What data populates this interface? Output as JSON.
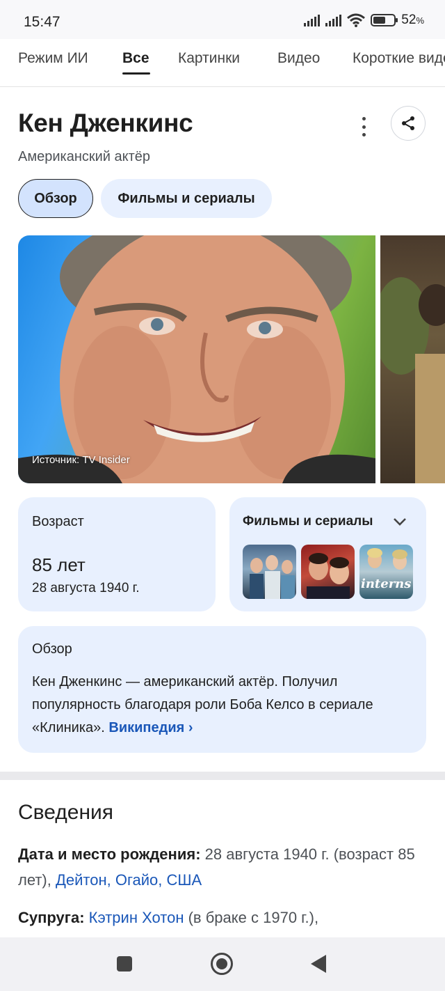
{
  "status_bar": {
    "time": "15:47",
    "battery_percent": "52",
    "battery_unit": "%",
    "icons": [
      "signal-icon",
      "signal-icon",
      "wifi-icon",
      "battery-icon"
    ]
  },
  "tabs": [
    {
      "label": "Режим ИИ",
      "active": false
    },
    {
      "label": "Все",
      "active": true
    },
    {
      "label": "Картинки",
      "active": false
    },
    {
      "label": "Видео",
      "active": false
    },
    {
      "label": "Короткие видео",
      "active": false
    }
  ],
  "knowledge_panel": {
    "title": "Кен Дженкинс",
    "subtitle": "Американский актёр",
    "chips": [
      "Обзор",
      "Фильмы и сериалы"
    ],
    "photo_credit": "Источник: TV Insider",
    "age_card": {
      "label": "Возраст",
      "value": "85 лет",
      "date": "28 августа 1940 г."
    },
    "films_card": {
      "title": "Фильмы и сериалы",
      "thumb_3_text": "interns"
    },
    "overview_card": {
      "label": "Обзор",
      "text": "Кен Дженкинс — американский актёр. Получил популярность благодаря роли Боба Келсо в сериале «Клиника».",
      "link": "Википедия"
    }
  },
  "details": {
    "title": "Сведения",
    "birth": {
      "label": "Дата и место рождения:",
      "value": " 28 августа 1940 г. (возраст 85 лет), ",
      "link": "Дейтон, Огайо, США"
    },
    "spouse": {
      "label": "Супруга:",
      "link": "Кэтрин Хотон",
      "value": " (в браке с 1970 г.),"
    }
  },
  "colors": {
    "accent_link": "#1a57b8",
    "chip_bg": "#e8f0fe",
    "chip_active_bg": "#d3e3fd"
  }
}
